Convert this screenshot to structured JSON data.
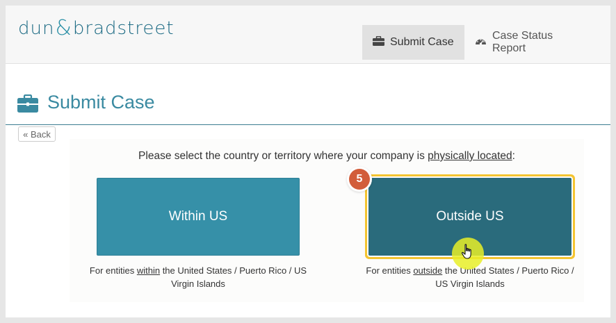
{
  "brand": {
    "part1": "dun",
    "amp": "&",
    "part2": "bradstreet"
  },
  "nav": {
    "submit_case": {
      "label": "Submit Case",
      "icon": "briefcase-icon"
    },
    "case_status": {
      "label": "Case Status Report",
      "icon": "dashboard-gauge-icon"
    }
  },
  "page": {
    "title": "Submit Case",
    "title_icon": "briefcase-icon"
  },
  "back_label": "« Back",
  "prompt": {
    "before": "Please select the country or territory where your company is ",
    "emphasis": "physically located",
    "after": ":"
  },
  "options": {
    "within": {
      "label": "Within US",
      "desc_before": "For entities ",
      "desc_emphasis": "within",
      "desc_after": " the United States / Puerto Rico / US Virgin Islands"
    },
    "outside": {
      "label": "Outside US",
      "desc_before": "For entities ",
      "desc_emphasis": "outside",
      "desc_after": " the United States / Puerto Rico / US Virgin Islands"
    }
  },
  "step_badge": "5",
  "colors": {
    "brand": "#1d6b84",
    "within_button": "#3690a8",
    "outside_button": "#2a6b7c",
    "highlight": "#f4c431",
    "badge": "#d25d3a",
    "click_indicator": "#e8ee28"
  }
}
